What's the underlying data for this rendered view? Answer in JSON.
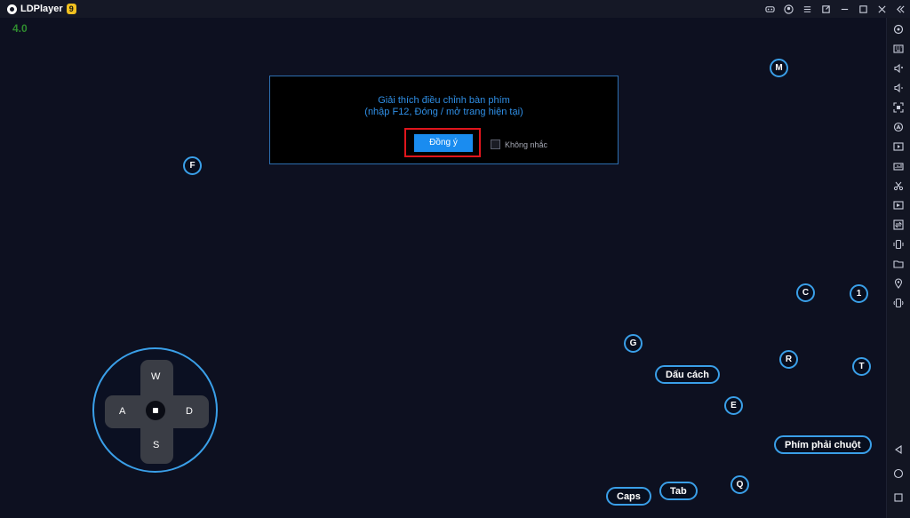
{
  "titlebar": {
    "app_name": "LDPlayer",
    "version_badge": "9"
  },
  "fps": "4.0",
  "dialog": {
    "title": "Giải thích điều chỉnh bàn phím",
    "subtitle": "(nhập F12, Đóng / mở trang hiện tại)",
    "ok_label": "Đồng ý",
    "dont_remind_label": "Không nhắc"
  },
  "keys": {
    "m": "M",
    "f": "F",
    "c": "C",
    "one": "1",
    "g": "G",
    "r": "R",
    "t": "T",
    "space": "Dấu cách",
    "e": "E",
    "right_click": "Phím phải chuột",
    "q": "Q",
    "tab": "Tab",
    "caps": "Caps"
  },
  "joystick": {
    "up": "W",
    "left": "A",
    "right": "D",
    "down": "S"
  }
}
